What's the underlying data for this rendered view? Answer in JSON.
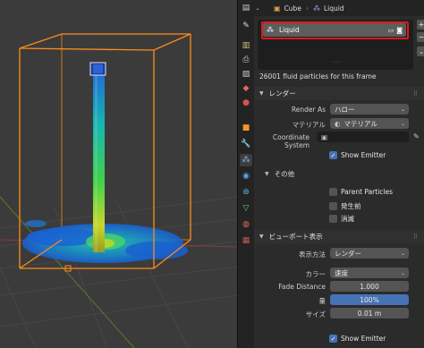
{
  "header": {
    "breadcrumb": [
      "Cube",
      "Liquid"
    ],
    "breadcrumb_icons": [
      "square-icon",
      "fluid-icon"
    ]
  },
  "particle_list": {
    "item_label": "Liquid",
    "add_button": "+",
    "remove_button": "−",
    "menu_button": "⌄"
  },
  "info_text": "26001 fluid particles for this frame",
  "render_panel": {
    "title": "レンダー",
    "render_as_label": "Render As",
    "render_as_value": "ハロー",
    "material_label": "マテリアル",
    "material_value": "マテリアル",
    "coord_label": "Coordinate System",
    "show_emitter_label": "Show Emitter",
    "show_emitter_checked": true,
    "extras": {
      "title": "その他",
      "parent_particles_label": "Parent Particles",
      "parent_particles_checked": false,
      "unborn_label": "発生前",
      "unborn_checked": false,
      "died_label": "消滅",
      "died_checked": false
    }
  },
  "viewport_display": {
    "title": "ビューポート表示",
    "display_as_label": "表示方法",
    "display_as_value": "レンダー",
    "color_label": "カラー",
    "color_value": "速度",
    "fade_label": "Fade Distance",
    "fade_value": "1.000",
    "amount_label": "量",
    "amount_value": "100%",
    "amount_fraction": 1.0,
    "size_label": "サイズ",
    "size_value": "0.01 m",
    "show_emitter_label": "Show Emitter",
    "show_emitter_checked": true
  },
  "colors": {
    "accent_blue": "#4772b3",
    "highlight_red": "#e01818",
    "selection_orange": "#ff8c1a",
    "viewport_bg": "#3b3b3b"
  }
}
